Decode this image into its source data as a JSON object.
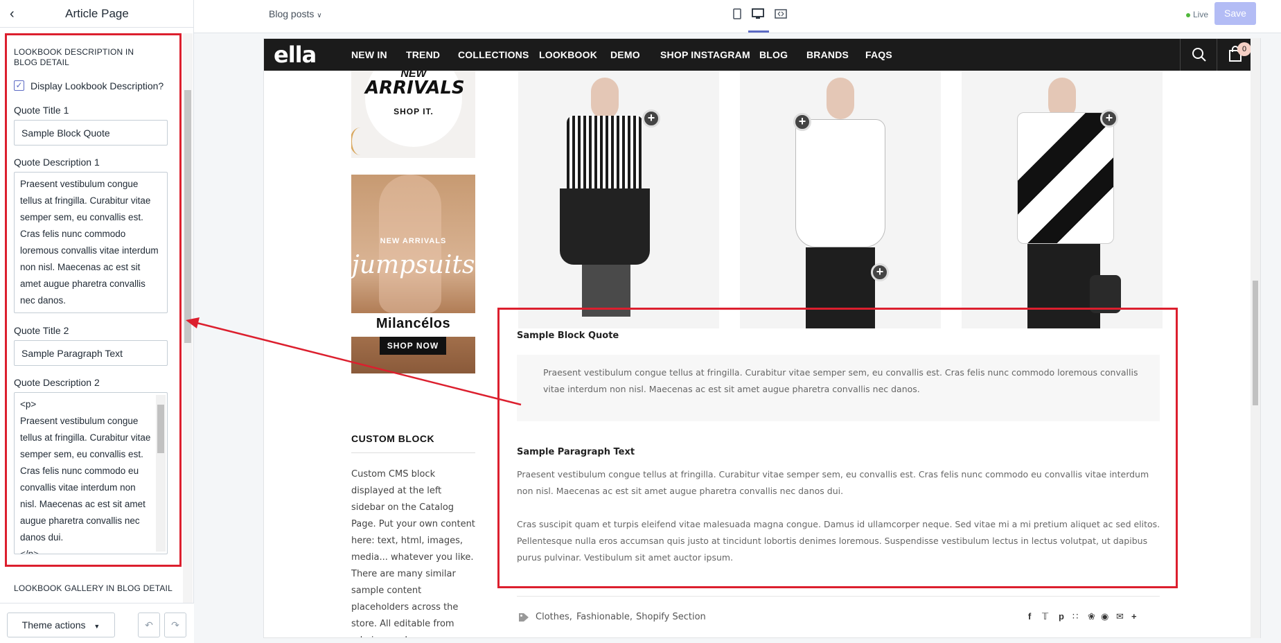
{
  "editor": {
    "back_icon": "chevron-left",
    "title": "Article Page",
    "section_title": "LOOKBOOK DESCRIPTION IN BLOG DETAIL",
    "checkbox_label": "Display Lookbook Description?",
    "checkbox_checked": true,
    "quote_title_1_label": "Quote Title 1",
    "quote_title_1_value": "Sample Block Quote",
    "quote_desc_1_label": "Quote Description 1",
    "quote_desc_1_value": "Praesent vestibulum congue tellus at fringilla. Curabitur vitae semper sem, eu convallis est. Cras felis nunc commodo loremous convallis vitae interdum non nisl. Maecenas ac est sit amet augue pharetra convallis nec danos.",
    "quote_title_2_label": "Quote Title 2",
    "quote_title_2_value": "Sample Paragraph Text",
    "quote_desc_2_label": "Quote Description 2",
    "quote_desc_2_value": "<p>\nPraesent vestibulum congue tellus at fringilla. Curabitur vitae semper sem, eu convallis est. Cras felis nunc commodo eu convallis vitae interdum non nisl. Maecenas ac est sit amet augue pharetra convallis nec danos dui.\n</p>",
    "next_section_title": "LOOKBOOK GALLERY IN BLOG DETAIL",
    "theme_actions_label": "Theme actions",
    "undo_icon": "undo-icon",
    "redo_icon": "redo-icon"
  },
  "topbar": {
    "page_selector": "Blog posts",
    "live_label": "Live",
    "save_label": "Save",
    "accent": "#5c6ac4",
    "save_color": "#b3bcf5"
  },
  "store": {
    "logo": "ella",
    "nav": [
      "NEW IN",
      "TREND",
      "COLLECTIONS",
      "LOOKBOOK",
      "DEMO",
      "SHOP INSTAGRAM",
      "BLOG",
      "BRANDS",
      "FAQS"
    ],
    "cart_count": "0",
    "banner1": {
      "line1": "NEW",
      "line2": "ARRIVALS",
      "cta": "SHOP IT."
    },
    "banner2": {
      "tag": "NEW ARRIVALS",
      "script": "jumpsuits",
      "brand": "Milancélos",
      "cta": "SHOP NOW"
    },
    "custom_block_title": "CUSTOM BLOCK",
    "custom_block_p1": "Custom CMS block displayed at the left sidebar on the Catalog Page. Put your own content here: text, html, images, media... whatever you like.",
    "custom_block_p2": "There are many similar sample content placeholders across the store. All editable from admin panel.",
    "quote_title": "Sample Block Quote",
    "quote_text": "Praesent vestibulum congue tellus at fringilla. Curabitur vitae semper sem, eu convallis est. Cras felis nunc commodo loremous convallis vitae interdum non nisl. Maecenas ac est sit amet augue pharetra convallis nec danos.",
    "para_title": "Sample Paragraph Text",
    "para_text_1": "Praesent vestibulum congue tellus at fringilla. Curabitur vitae semper sem, eu convallis est. Cras felis nunc commodo eu convallis vitae interdum non nisl. Maecenas ac est sit amet augue pharetra convallis nec danos dui.",
    "para_text_2": "Cras suscipit quam et turpis eleifend vitae malesuada magna congue. Damus id ullamcorper neque. Sed vitae mi a mi pretium aliquet ac sed elitos. Pellentesque nulla eros accumsan quis justo at tincidunt lobortis denimes loremous. Suspendisse vestibulum lectus in lectus volutpat, ut dapibus purus pulvinar. Vestibulum sit amet auctor ipsum.",
    "tags": [
      "Clothes,",
      "Fashionable,",
      "Shopify Section"
    ],
    "social_icons": [
      "facebook-icon",
      "twitter-icon",
      "pinterest-icon",
      "grid-icon",
      "snapchat-icon",
      "reddit-icon",
      "mail-icon",
      "plus-icon"
    ],
    "highlight_color": "#dc1f2e"
  }
}
